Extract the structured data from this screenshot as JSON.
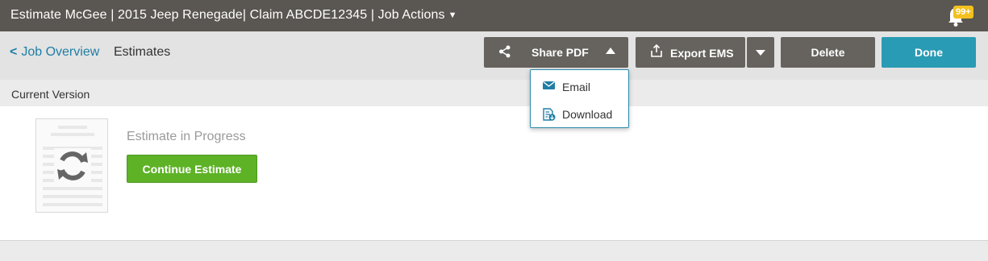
{
  "header": {
    "title": "Estimate McGee | 2015 Jeep Renegade| Claim ABCDE12345  | Job Actions",
    "job_actions_caret": "▼",
    "notification_icon": "bell-icon",
    "notification_count": "99+"
  },
  "breadcrumb": {
    "parent": "Job Overview",
    "current": "Estimates"
  },
  "toolbar": {
    "share_pdf": "Share PDF",
    "export_ems": "Export EMS",
    "delete": "Delete",
    "done": "Done"
  },
  "share_menu": {
    "items": [
      {
        "label": "Email",
        "icon": "envelope-icon"
      },
      {
        "label": "Download",
        "icon": "document-download-icon"
      }
    ]
  },
  "version": {
    "label": "Current Version",
    "status": "Estimate in Progress",
    "continue": "Continue Estimate"
  },
  "colors": {
    "header_bg": "#5a5651",
    "link": "#1f7ea5",
    "primary": "#2a9bb4",
    "success": "#5db226",
    "badge": "#f4c01e",
    "dark_button": "#66625e"
  }
}
